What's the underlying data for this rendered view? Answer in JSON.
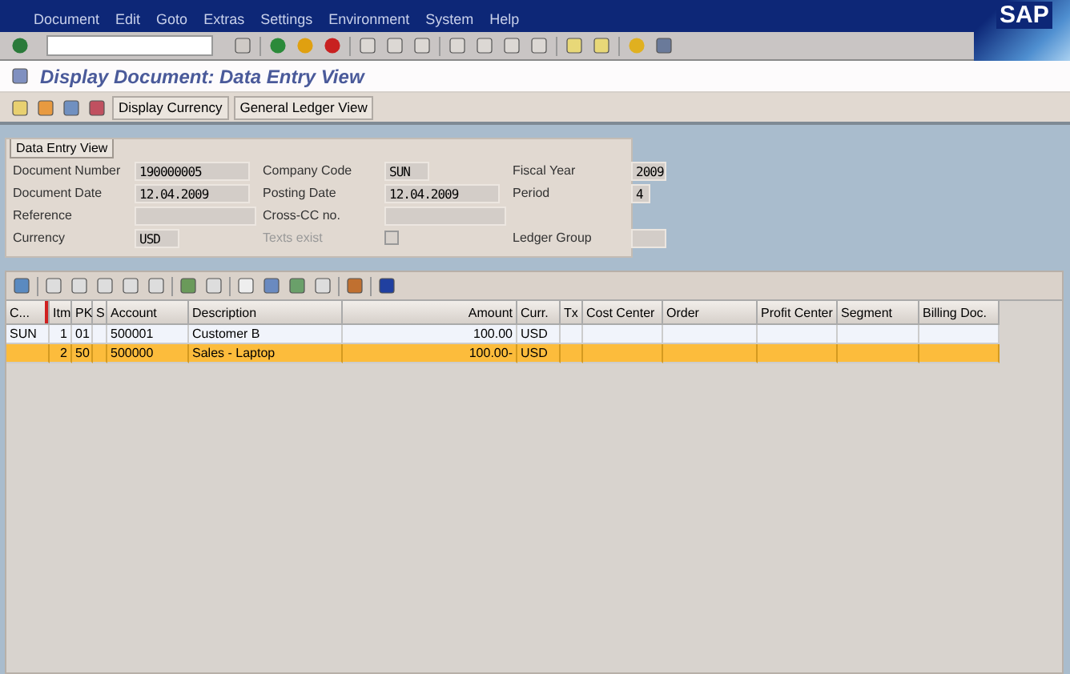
{
  "menu": [
    "Document",
    "Edit",
    "Goto",
    "Extras",
    "Settings",
    "Environment",
    "System",
    "Help"
  ],
  "logo": "SAP",
  "title": "Display Document: Data Entry View",
  "app_buttons": [
    "Display Currency",
    "General Ledger View"
  ],
  "form": {
    "tab": "Data Entry View",
    "fields": [
      {
        "kind": "field",
        "label": "Document Number",
        "value": "190000005"
      },
      {
        "kind": "field",
        "label": "Company Code",
        "value": "SUN"
      },
      {
        "kind": "field",
        "label": "Fiscal Year",
        "value": "2009"
      },
      {
        "kind": "field",
        "label": "Document Date",
        "value": "12.04.2009"
      },
      {
        "kind": "field",
        "label": "Posting Date",
        "value": "12.04.2009"
      },
      {
        "kind": "field",
        "label": "Period",
        "value": "4"
      },
      {
        "kind": "field",
        "label": "Reference"
      },
      {
        "kind": "field",
        "label": "Cross-CC no."
      },
      {
        "kind": "empty"
      },
      {
        "kind": "field",
        "label": "Currency",
        "value": "USD"
      },
      {
        "kind": "checkbox",
        "label": "Texts exist",
        "checked": false,
        "disabled": true
      },
      {
        "kind": "field",
        "label": "Ledger Group"
      }
    ]
  },
  "table": {
    "columns": [
      {
        "label": "C...",
        "sorted": true
      },
      {
        "label": "Itm"
      },
      {
        "label": "PK"
      },
      {
        "label": "S"
      },
      {
        "label": "Account"
      },
      {
        "label": "Description"
      },
      {
        "label": "Amount"
      },
      {
        "label": "Curr."
      },
      {
        "label": "Tx"
      },
      {
        "label": "Cost Center"
      },
      {
        "label": "Order"
      },
      {
        "label": "Profit Center"
      },
      {
        "label": "Segment"
      },
      {
        "label": "Billing Doc."
      }
    ],
    "rows": [
      {
        "selected": false,
        "cells": [
          "SUN",
          "1",
          "01",
          null,
          "500001",
          "Customer B",
          "100.00",
          "USD",
          null,
          null,
          null,
          null,
          null,
          null
        ]
      },
      {
        "selected": true,
        "cells": [
          null,
          "2",
          "50",
          null,
          "500000",
          "Sales - Laptop",
          "100.00-",
          "USD",
          null,
          null,
          null,
          null,
          null,
          null
        ]
      }
    ]
  }
}
